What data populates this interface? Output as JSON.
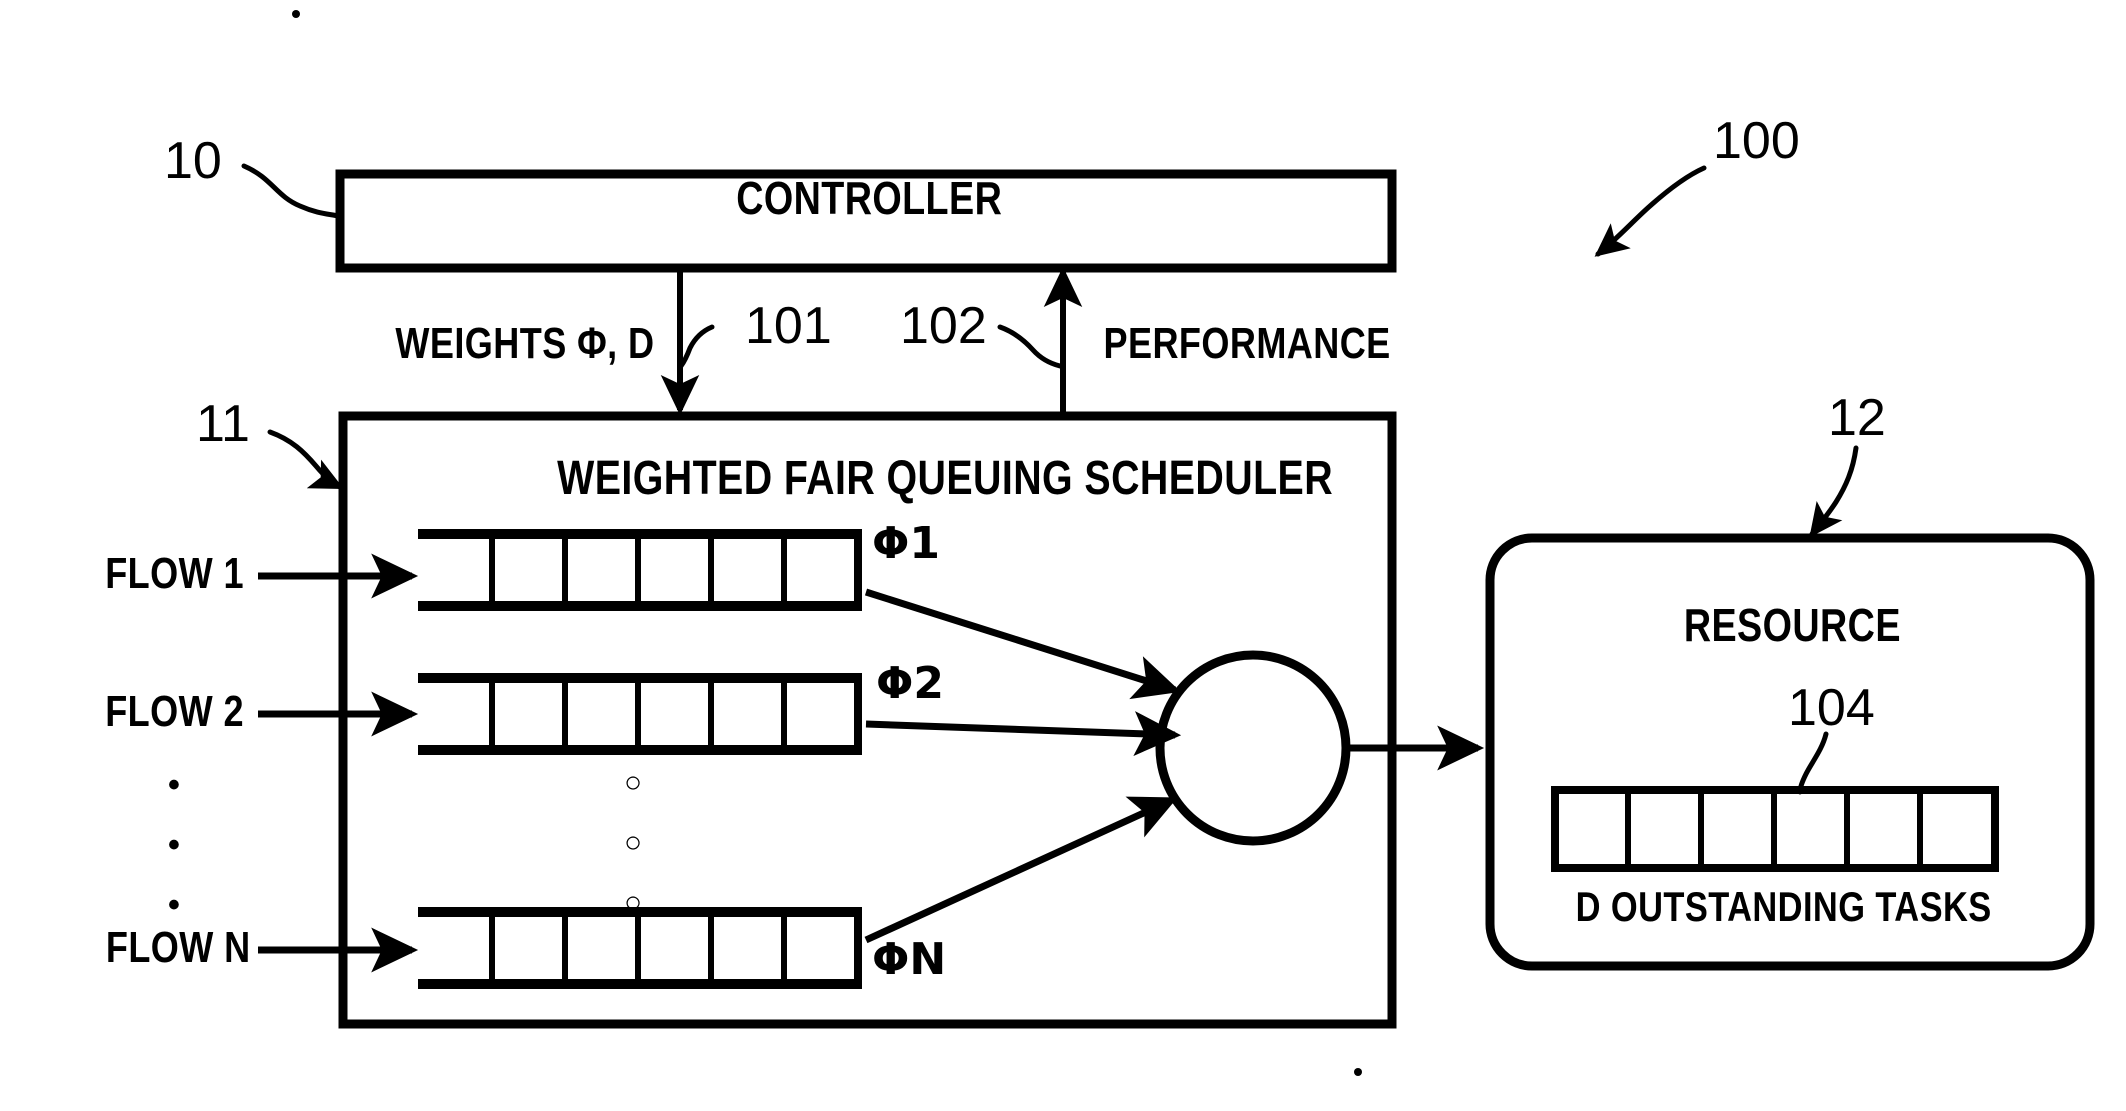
{
  "figure": {
    "type": "patent-diagram",
    "title": "Weighted fair queuing scheduler system block diagram",
    "background_color": "#ffffff",
    "line_color": "#000000"
  },
  "system_ref": "100",
  "blocks": {
    "controller": {
      "label": "CONTROLLER",
      "ref": "10"
    },
    "scheduler": {
      "label": "WEIGHTED FAIR QUEUING SCHEDULER",
      "ref": "11"
    },
    "resource": {
      "label": "RESOURCE",
      "ref": "12",
      "buffer_ref": "104",
      "buffer_caption": "D OUTSTANDING TASKS",
      "buffer_cells": 6
    }
  },
  "signals": [
    {
      "name": "weights",
      "label": "WEIGHTS Φ, D",
      "ref": "101",
      "direction": "controller-to-scheduler"
    },
    {
      "name": "performance",
      "label": "PERFORMANCE",
      "ref": "102",
      "direction": "scheduler-to-controller"
    }
  ],
  "flows": [
    {
      "label": "FLOW 1",
      "weight_label": "Φ1",
      "cells": 6
    },
    {
      "label": "FLOW 2",
      "weight_label": "Φ2",
      "cells": 6
    },
    {
      "label": "FLOW N",
      "weight_label": "ΦN",
      "cells": 6
    }
  ],
  "ellipsis": {
    "flow_dots": "•",
    "queue_dots": "○",
    "count": 3
  }
}
